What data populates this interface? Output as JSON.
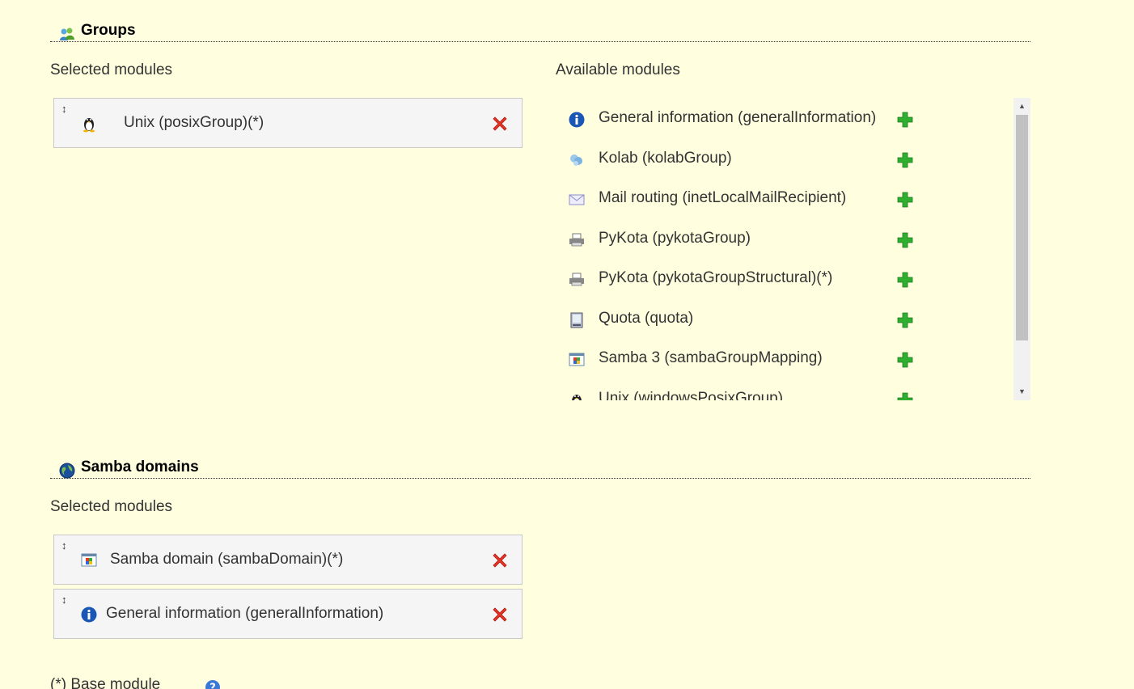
{
  "groups": {
    "title": "Groups",
    "title_icon": "group-icon",
    "selected_label": "Selected modules",
    "available_label": "Available modules",
    "selected": [
      {
        "label": "Unix (posixGroup)(*)",
        "icon": "tux-icon"
      }
    ],
    "available": [
      {
        "label": "General information (generalInformation)",
        "icon": "info-icon"
      },
      {
        "label": "Kolab (kolabGroup)",
        "icon": "kolab-icon"
      },
      {
        "label": "Mail routing (inetLocalMailRecipient)",
        "icon": "mail-icon"
      },
      {
        "label": "PyKota (pykotaGroup)",
        "icon": "printer-icon"
      },
      {
        "label": "PyKota (pykotaGroupStructural)(*)",
        "icon": "printer-icon"
      },
      {
        "label": "Quota (quota)",
        "icon": "quota-icon"
      },
      {
        "label": "Samba 3 (sambaGroupMapping)",
        "icon": "samba-icon"
      },
      {
        "label": "Unix (windowsPosixGroup)",
        "icon": "tux-icon"
      }
    ]
  },
  "samba_domains": {
    "title": "Samba domains",
    "title_icon": "globe-icon",
    "selected_label": "Selected modules",
    "selected": [
      {
        "label": "Samba domain (sambaDomain)(*)",
        "icon": "samba-icon"
      },
      {
        "label": "General information (generalInformation)",
        "icon": "info-icon"
      }
    ]
  },
  "footer": {
    "base_module_note": "(*) Base module",
    "help_icon": "help-icon"
  },
  "colors": {
    "background": "#ffffdf",
    "remove": "#e53527",
    "add": "#2fae2f",
    "info": "#1a56b5"
  }
}
